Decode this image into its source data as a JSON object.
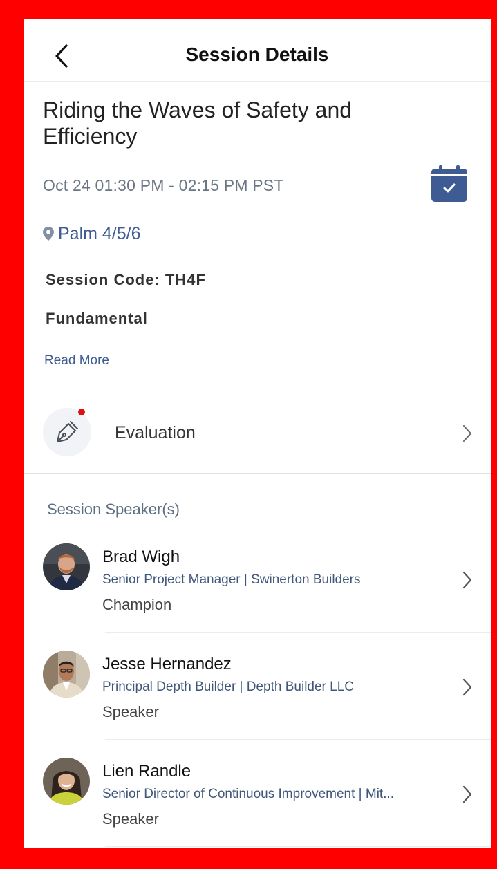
{
  "header": {
    "title": "Session Details"
  },
  "session": {
    "title": "Riding the Waves of Safety and Efficiency",
    "time": "Oct 24  01:30 PM - 02:15 PM  PST",
    "location": "Palm 4/5/6",
    "code": "Session Code: TH4F",
    "level": "Fundamental",
    "read_more": "Read More"
  },
  "evaluation": {
    "label": "Evaluation",
    "has_notification": true
  },
  "speakers_heading": "Session Speaker(s)",
  "speakers": [
    {
      "name": "Brad Wigh",
      "title": "Senior Project Manager | Swinerton Builders",
      "role": "Champion"
    },
    {
      "name": "Jesse Hernandez",
      "title": "Principal Depth Builder | Depth Builder LLC",
      "role": "Speaker"
    },
    {
      "name": "Lien Randle",
      "title": "Senior Director of Continuous Improvement | Mit...",
      "role": "Speaker"
    }
  ],
  "colors": {
    "accent": "#3e5b93",
    "frame_border": "#ff0000",
    "notification": "#e01010"
  },
  "icons": {
    "back": "chevron-left-icon",
    "calendar": "calendar-check-icon",
    "location": "map-pin-icon",
    "evaluation": "pen-icon",
    "row_arrow": "chevron-right-icon"
  }
}
